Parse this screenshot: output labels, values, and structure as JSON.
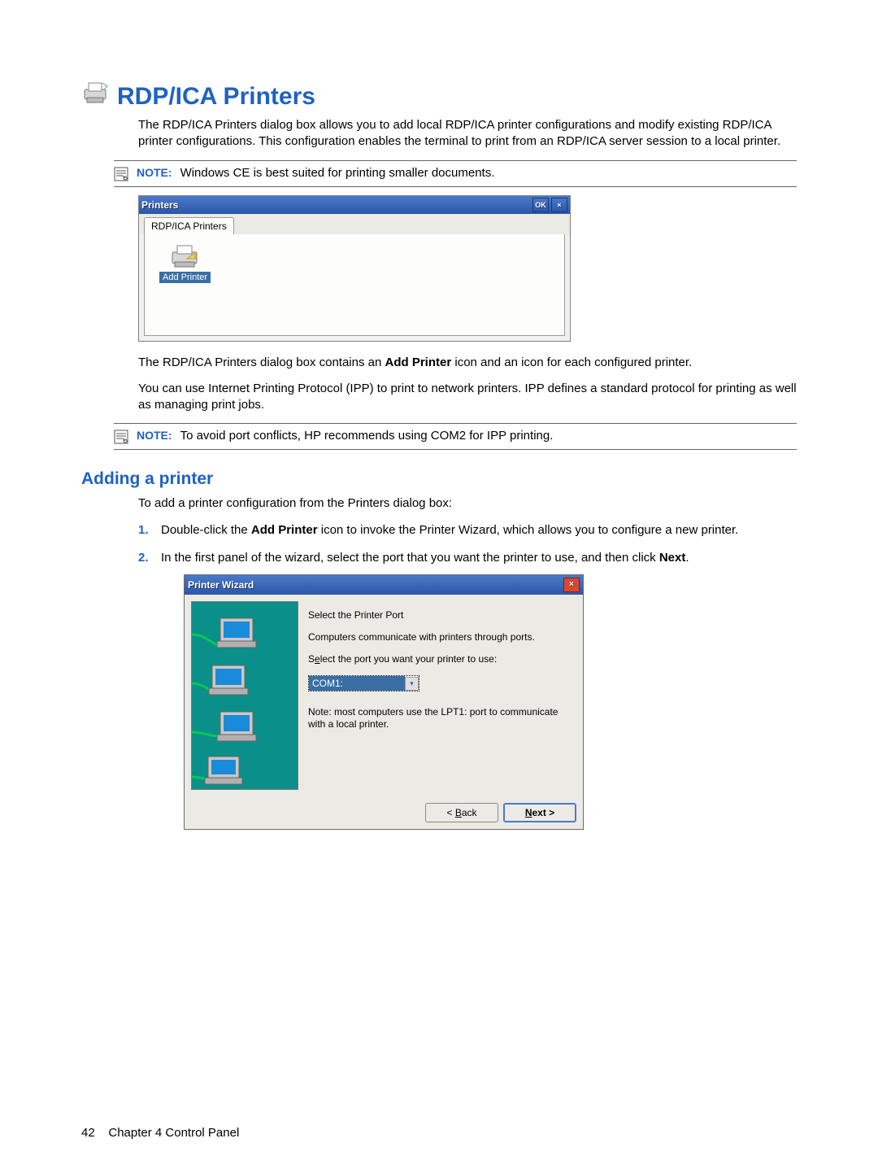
{
  "heading": "RDP/ICA Printers",
  "intro": "The RDP/ICA Printers dialog box allows you to add local RDP/ICA printer configurations and modify existing RDP/ICA printer configurations. This configuration enables the terminal to print from an RDP/ICA server session to a local printer.",
  "note1": {
    "label": "NOTE:",
    "text": "Windows CE is best suited for printing smaller documents."
  },
  "dlg1": {
    "title": "Printers",
    "ok": "OK",
    "close": "×",
    "tab": "RDP/ICA Printers",
    "add_printer_label": "Add Printer"
  },
  "para2_pre": "The RDP/ICA Printers dialog box contains an ",
  "para2_bold": "Add Printer",
  "para2_post": " icon and an icon for each configured printer.",
  "para3": "You can use Internet Printing Protocol (IPP) to print to network printers. IPP defines a standard protocol for printing as well as managing print jobs.",
  "note2": {
    "label": "NOTE:",
    "text": "To avoid port conflicts, HP recommends using COM2 for IPP printing."
  },
  "subheading": "Adding a printer",
  "sub_intro": "To add a printer configuration from the Printers dialog box:",
  "steps": {
    "s1_pre": "Double-click the ",
    "s1_bold": "Add Printer",
    "s1_post": " icon to invoke the Printer Wizard, which allows you to configure a new printer.",
    "s2_pre": "In the first panel of the wizard, select the port that you want the printer to use, and then click ",
    "s2_bold": "Next",
    "s2_post": "."
  },
  "dlg2": {
    "title": "Printer Wizard",
    "close": "×",
    "h": "Select the Printer Port",
    "p1": "Computers communicate with printers through ports.",
    "p2_pre": "S",
    "p2_ul": "e",
    "p2_post": "lect the port you want your printer to use:",
    "port_value": "COM1:",
    "p3": "Note: most computers use the LPT1: port to communicate with a local printer.",
    "back_pre": "< ",
    "back_ul": "B",
    "back_post": "ack",
    "next_ul": "N",
    "next_post": "ext >"
  },
  "footer": {
    "page": "42",
    "chapter": "Chapter 4   Control Panel"
  }
}
